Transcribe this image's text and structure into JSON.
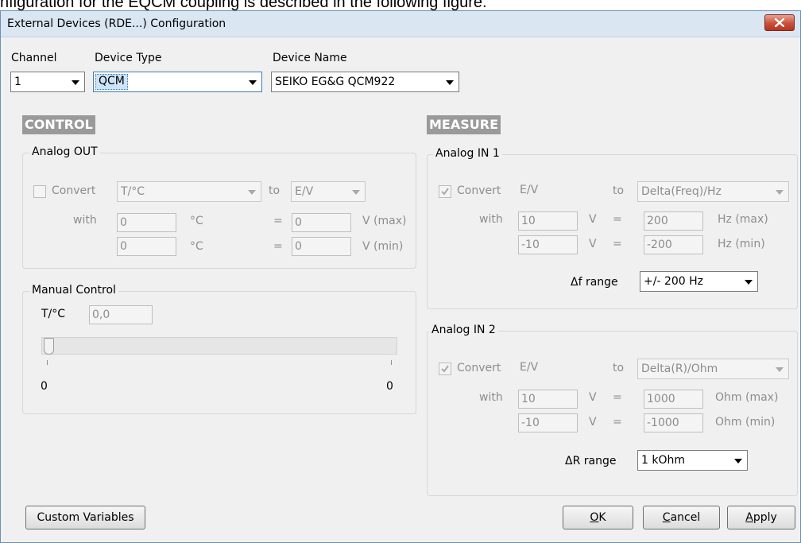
{
  "doc_text": "nfiguration for the EQCM coupling is described in the following figure.",
  "window": {
    "title": "External Devices (RDE...) Configuration"
  },
  "top": {
    "channel_label": "Channel",
    "channel_value": "1",
    "device_type_label": "Device Type",
    "device_type_value": "QCM",
    "device_name_label": "Device Name",
    "device_name_value": "SEIKO EG&G QCM922"
  },
  "control": {
    "header": "CONTROL",
    "analog_out": {
      "title": "Analog OUT",
      "convert_label": "Convert",
      "convert_checked": false,
      "from_value": "T/°C",
      "to_label": "to",
      "to_value": "E/V",
      "with_label": "with",
      "max_in": "0",
      "max_unit": "°C",
      "eq1": "=",
      "max_out": "0",
      "max_out_unit": "V (max)",
      "min_in": "0",
      "min_unit": "°C",
      "eq2": "=",
      "min_out": "0",
      "min_out_unit": "V (min)"
    },
    "manual": {
      "title": "Manual Control",
      "var_label": "T/°C",
      "value": "0,0",
      "slider_level": 0,
      "min_label": "0",
      "max_label": "0"
    }
  },
  "measure": {
    "header": "MEASURE",
    "in1": {
      "title": "Analog IN 1",
      "convert_label": "Convert",
      "convert_checked": true,
      "from_value": "E/V",
      "to_label": "to",
      "to_value": "Delta(Freq)/Hz",
      "with_label": "with",
      "max_in": "10",
      "max_in_unit": "V",
      "eq1": "=",
      "max_out": "200",
      "max_out_unit": "Hz (max)",
      "min_in": "-10",
      "min_in_unit": "V",
      "eq2": "=",
      "min_out": "-200",
      "min_out_unit": "Hz (min)",
      "range_label": "Δf range",
      "range_value": "+/- 200 Hz"
    },
    "in2": {
      "title": "Analog IN 2",
      "convert_label": "Convert",
      "convert_checked": true,
      "from_value": "E/V",
      "to_label": "to",
      "to_value": "Delta(R)/Ohm",
      "with_label": "with",
      "max_in": "10",
      "max_in_unit": "V",
      "eq1": "=",
      "max_out": "1000",
      "max_out_unit": "Ohm (max)",
      "min_in": "-10",
      "min_in_unit": "V",
      "eq2": "=",
      "min_out": "-1000",
      "min_out_unit": "Ohm (min)",
      "range_label": "ΔR range",
      "range_value": "1 kOhm"
    }
  },
  "buttons": {
    "custom": "Custom Variables",
    "ok_u": "O",
    "ok_rest": "K",
    "cancel_u": "C",
    "cancel_rest": "ancel",
    "apply_u": "A",
    "apply_rest": "pply"
  }
}
